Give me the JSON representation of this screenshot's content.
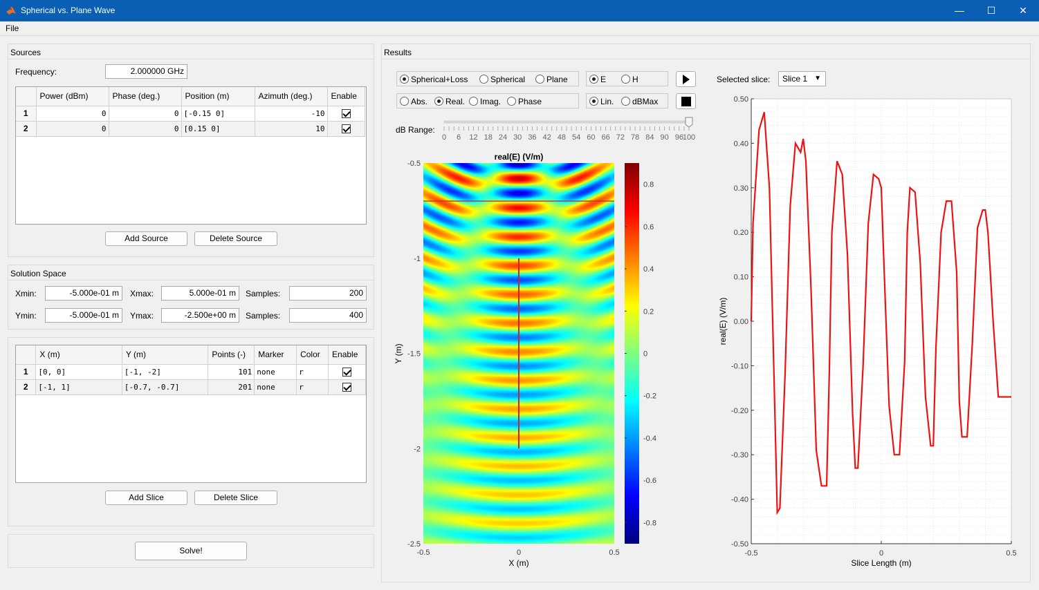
{
  "window": {
    "title": "Spherical vs. Plane Wave"
  },
  "menu": {
    "file": "File"
  },
  "sources": {
    "title": "Sources",
    "frequency_label": "Frequency:",
    "frequency_value": "2.000000 GHz",
    "columns": [
      "Power (dBm)",
      "Phase (deg.)",
      "Position (m)",
      "Azimuth (deg.)",
      "Enable"
    ],
    "rows": [
      {
        "id": "1",
        "power": "0",
        "phase": "0",
        "position": "[-0.15 0]",
        "azimuth": "-10",
        "enabled": true
      },
      {
        "id": "2",
        "power": "0",
        "phase": "0",
        "position": "[0.15 0]",
        "azimuth": "10",
        "enabled": true
      }
    ],
    "add_label": "Add Source",
    "delete_label": "Delete Source"
  },
  "solution": {
    "title": "Solution Space",
    "xmin_label": "Xmin:",
    "xmin": "-5.000e-01 m",
    "xmax_label": "Xmax:",
    "xmax": "5.000e-01 m",
    "xsamples_label": "Samples:",
    "xsamples": "200",
    "ymin_label": "Ymin:",
    "ymin": "-5.000e-01 m",
    "ymax_label": "Ymax:",
    "ymax": "-2.500e+00 m",
    "ysamples_label": "Samples:",
    "ysamples": "400"
  },
  "slices": {
    "columns": [
      "X (m)",
      "Y (m)",
      "Points (-)",
      "Marker",
      "Color",
      "Enable"
    ],
    "rows": [
      {
        "id": "1",
        "x": "[0, 0]",
        "y": "[-1, -2]",
        "points": "101",
        "marker": "none",
        "color": "r",
        "enabled": true
      },
      {
        "id": "2",
        "x": "[-1, 1]",
        "y": "[-0.7, -0.7]",
        "points": "201",
        "marker": "none",
        "color": "r",
        "enabled": true
      }
    ],
    "add_label": "Add Slice",
    "delete_label": "Delete Slice"
  },
  "solve_label": "Solve!",
  "results": {
    "title": "Results",
    "model_options": [
      "Spherical+Loss",
      "Spherical",
      "Plane"
    ],
    "model_selected": "Spherical+Loss",
    "field_options": [
      "E",
      "H"
    ],
    "field_selected": "E",
    "component_options": [
      "Abs.",
      "Real.",
      "Imag.",
      "Phase"
    ],
    "component_selected": "Real.",
    "scale_options": [
      "Lin.",
      "dBMax"
    ],
    "scale_selected": "Lin.",
    "db_range_label": "dB Range:",
    "db_range_value": 100,
    "db_ticks": [
      "0",
      "6",
      "12",
      "18",
      "24",
      "30",
      "36",
      "42",
      "48",
      "54",
      "60",
      "66",
      "72",
      "78",
      "84",
      "90",
      "96",
      "100"
    ],
    "selected_slice_label": "Selected slice:",
    "selected_slice": "Slice 1",
    "play_icon": "play-icon",
    "stop_icon": "stop-icon"
  },
  "chart_data": [
    {
      "type": "heatmap",
      "title": "real(E) (V/m)",
      "xlabel": "X (m)",
      "ylabel": "Y (m)",
      "xlim": [
        -0.5,
        0.5
      ],
      "ylim": [
        -2.5,
        -0.5
      ],
      "x_ticks": [
        "-0.5",
        "0",
        "0.5"
      ],
      "y_ticks": [
        "-0.5",
        "-1",
        "-1.5",
        "-2",
        "-2.5"
      ],
      "colorbar": {
        "range": [
          -0.9,
          0.9
        ],
        "ticks": [
          "0.8",
          "0.6",
          "0.4",
          "0.2",
          "0",
          "-0.2",
          "-0.4",
          "-0.6",
          "-0.8"
        ],
        "colormap": "jet"
      },
      "sources": [
        {
          "x": -0.15,
          "y": 0,
          "azimuth": -10
        },
        {
          "x": 0.15,
          "y": 0,
          "azimuth": 10
        }
      ],
      "wavelength": 0.15,
      "slice_lines": [
        {
          "x": [
            0,
            0
          ],
          "y": [
            -1,
            -2
          ],
          "color": "#d62020"
        },
        {
          "x": [
            -1,
            1
          ],
          "y": [
            -0.7,
            -0.7
          ],
          "color": "#c03030"
        }
      ]
    },
    {
      "type": "line",
      "title": "",
      "xlabel": "Slice Length (m)",
      "ylabel": "real(E) (V/m)",
      "xlim": [
        -0.5,
        0.5
      ],
      "ylim": [
        -0.5,
        0.5
      ],
      "x_ticks": [
        "-0.5",
        "0",
        "0.5"
      ],
      "y_ticks": [
        "0.50",
        "0.40",
        "0.30",
        "0.20",
        "0.10",
        "0.00",
        "-0.10",
        "-0.20",
        "-0.30",
        "-0.40",
        "-0.50"
      ],
      "grid": true,
      "series": [
        {
          "color": "#ee1111",
          "x": [
            -0.5,
            -0.493,
            -0.47,
            -0.45,
            -0.43,
            -0.41,
            -0.4,
            -0.39,
            -0.37,
            -0.35,
            -0.33,
            -0.31,
            -0.3,
            -0.29,
            -0.27,
            -0.25,
            -0.23,
            -0.21,
            -0.2,
            -0.19,
            -0.17,
            -0.15,
            -0.13,
            -0.11,
            -0.1,
            -0.09,
            -0.07,
            -0.05,
            -0.03,
            -0.01,
            0,
            0.01,
            0.03,
            0.05,
            0.07,
            0.09,
            0.1,
            0.11,
            0.13,
            0.15,
            0.17,
            0.19,
            0.2,
            0.21,
            0.23,
            0.25,
            0.27,
            0.29,
            0.3,
            0.31,
            0.33,
            0.35,
            0.37,
            0.39,
            0.4,
            0.41,
            0.43,
            0.45,
            0.47,
            0.49,
            0.5
          ],
          "y": [
            0.0,
            0.22,
            0.43,
            0.47,
            0.3,
            -0.18,
            -0.43,
            -0.42,
            -0.12,
            0.26,
            0.4,
            0.38,
            0.41,
            0.36,
            0.07,
            -0.29,
            -0.37,
            -0.37,
            -0.12,
            0.2,
            0.36,
            0.33,
            0.15,
            -0.21,
            -0.33,
            -0.33,
            -0.1,
            0.22,
            0.33,
            0.32,
            0.3,
            0.13,
            -0.19,
            -0.3,
            -0.3,
            -0.09,
            0.2,
            0.3,
            0.29,
            0.13,
            -0.17,
            -0.28,
            -0.28,
            -0.06,
            0.2,
            0.27,
            0.27,
            0.11,
            -0.18,
            -0.26,
            -0.26,
            -0.05,
            0.21,
            0.25,
            0.25,
            0.2,
            0.0,
            -0.17,
            -0.17,
            -0.17,
            -0.17
          ]
        }
      ]
    }
  ]
}
